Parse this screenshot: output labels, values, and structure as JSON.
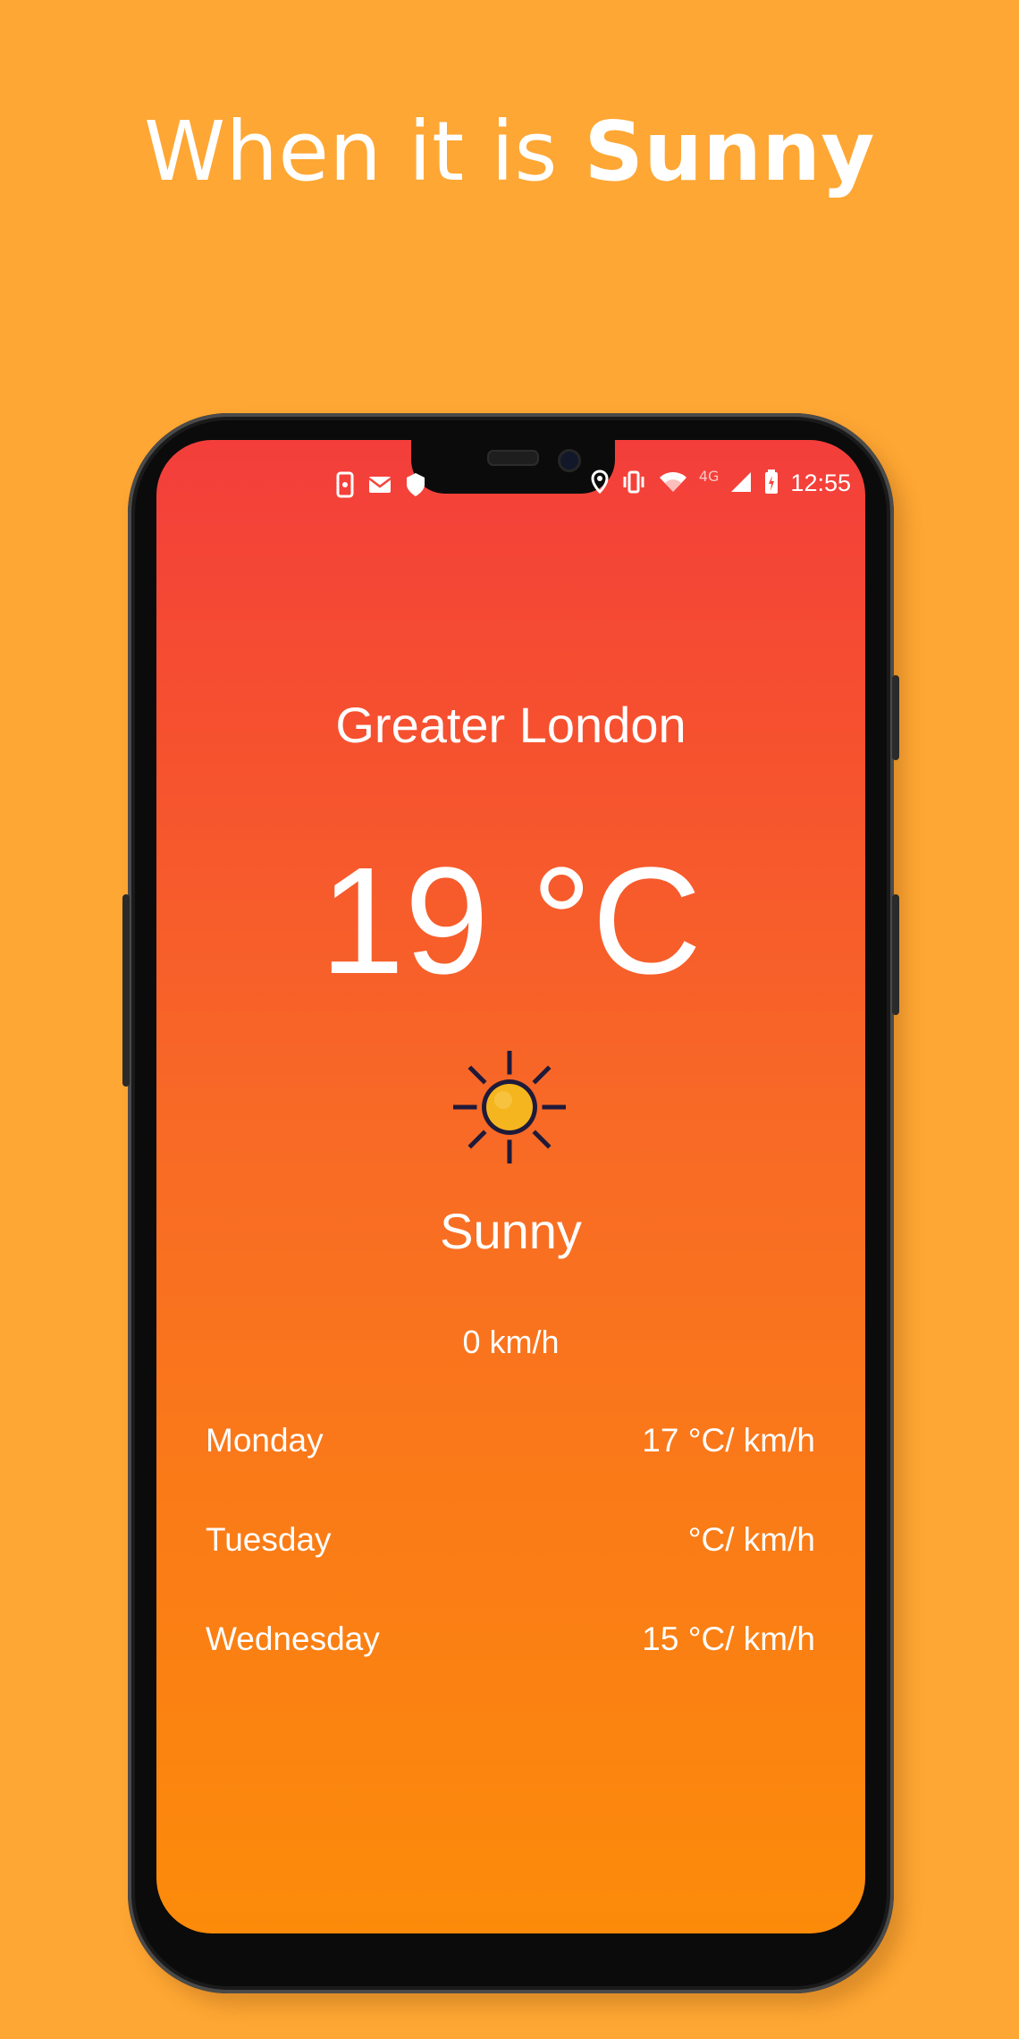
{
  "promo": {
    "headline_prefix": "When it is ",
    "headline_emphasis": "Sunny"
  },
  "status_bar": {
    "time": "12:55",
    "network": "4G",
    "icons": [
      "phone-icon",
      "mail-icon",
      "shield-icon",
      "location-icon",
      "vibrate-icon",
      "wifi-icon",
      "signal-icon",
      "battery-icon"
    ]
  },
  "weather": {
    "city": "Greater London",
    "temperature": "19 °C",
    "condition": "Sunny",
    "condition_icon": "sun-icon",
    "wind": "0 km/h"
  },
  "forecast": [
    {
      "day": "Monday",
      "value": "17 °C/ km/h"
    },
    {
      "day": "Tuesday",
      "value": "°C/ km/h"
    },
    {
      "day": "Wednesday",
      "value": "15 °C/ km/h"
    }
  ],
  "colors": {
    "background": "#FEA734",
    "gradient_top": "#F33E3B",
    "gradient_bottom": "#FC8B0A",
    "sun_fill": "#F5B51E",
    "sun_rays": "#1F1A3A"
  }
}
